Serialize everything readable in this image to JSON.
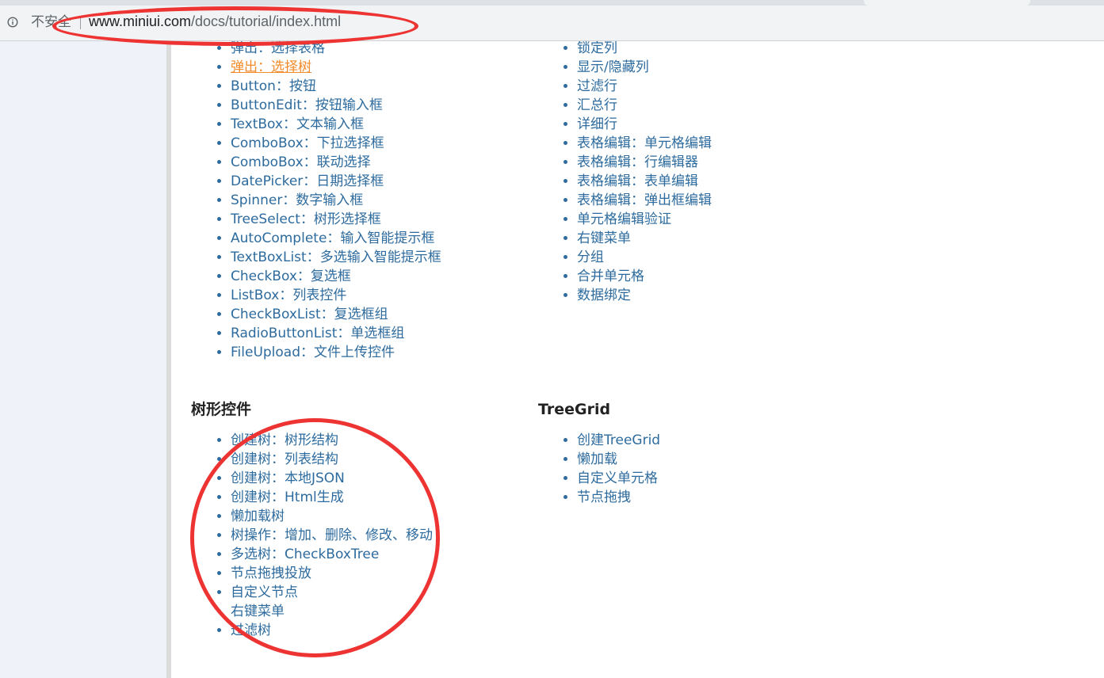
{
  "browser": {
    "security_label": "不安全",
    "url_host": "www.miniui.com",
    "url_path": "/docs/tutorial/index.html"
  },
  "form_controls": {
    "items": [
      {
        "label": "弹出：选择表格",
        "state": "normal"
      },
      {
        "label": "弹出：选择树",
        "state": "visited"
      },
      {
        "label": "Button：按钮",
        "state": "normal"
      },
      {
        "label": "ButtonEdit：按钮输入框",
        "state": "normal"
      },
      {
        "label": "TextBox：文本输入框",
        "state": "normal"
      },
      {
        "label": "ComboBox：下拉选择框",
        "state": "normal"
      },
      {
        "label": "ComboBox：联动选择",
        "state": "normal"
      },
      {
        "label": "DatePicker：日期选择框",
        "state": "normal"
      },
      {
        "label": "Spinner：数字输入框",
        "state": "normal"
      },
      {
        "label": "TreeSelect：树形选择框",
        "state": "normal"
      },
      {
        "label": "AutoComplete：输入智能提示框",
        "state": "normal"
      },
      {
        "label": "TextBoxList：多选输入智能提示框",
        "state": "normal"
      },
      {
        "label": "CheckBox：复选框",
        "state": "normal"
      },
      {
        "label": "ListBox：列表控件",
        "state": "normal"
      },
      {
        "label": "CheckBoxList：复选框组",
        "state": "normal"
      },
      {
        "label": "RadioButtonList：单选框组",
        "state": "normal"
      },
      {
        "label": "FileUpload：文件上传控件",
        "state": "normal"
      }
    ]
  },
  "datagrid": {
    "items": [
      {
        "label": "锁定列"
      },
      {
        "label": "显示/隐藏列"
      },
      {
        "label": "过滤行"
      },
      {
        "label": "汇总行"
      },
      {
        "label": "详细行"
      },
      {
        "label": "表格编辑：单元格编辑"
      },
      {
        "label": "表格编辑：行编辑器"
      },
      {
        "label": "表格编辑：表单编辑"
      },
      {
        "label": "表格编辑：弹出框编辑"
      },
      {
        "label": "单元格编辑验证"
      },
      {
        "label": "右键菜单"
      },
      {
        "label": "分组"
      },
      {
        "label": "合并单元格"
      },
      {
        "label": "数据绑定"
      }
    ]
  },
  "tree": {
    "title": "树形控件",
    "items": [
      {
        "label": "创建树：树形结构"
      },
      {
        "label": "创建树：列表结构"
      },
      {
        "label": "创建树：本地JSON"
      },
      {
        "label": "创建树：Html生成"
      },
      {
        "label": "懒加载树"
      },
      {
        "label": "树操作：增加、删除、修改、移动"
      },
      {
        "label": "多选树：CheckBoxTree"
      },
      {
        "label": "节点拖拽投放"
      },
      {
        "label": "自定义节点"
      },
      {
        "label": "右键菜单"
      },
      {
        "label": "过滤树"
      }
    ]
  },
  "treegrid": {
    "title": "TreeGrid",
    "items": [
      {
        "label": "创建TreeGrid"
      },
      {
        "label": "懒加载"
      },
      {
        "label": "自定义单元格"
      },
      {
        "label": "节点拖拽"
      }
    ]
  },
  "colors": {
    "link": "#2d6b9e",
    "visited_link": "#f28b2a",
    "annotation": "#ee3333",
    "sidebar": "#eff3f9"
  }
}
